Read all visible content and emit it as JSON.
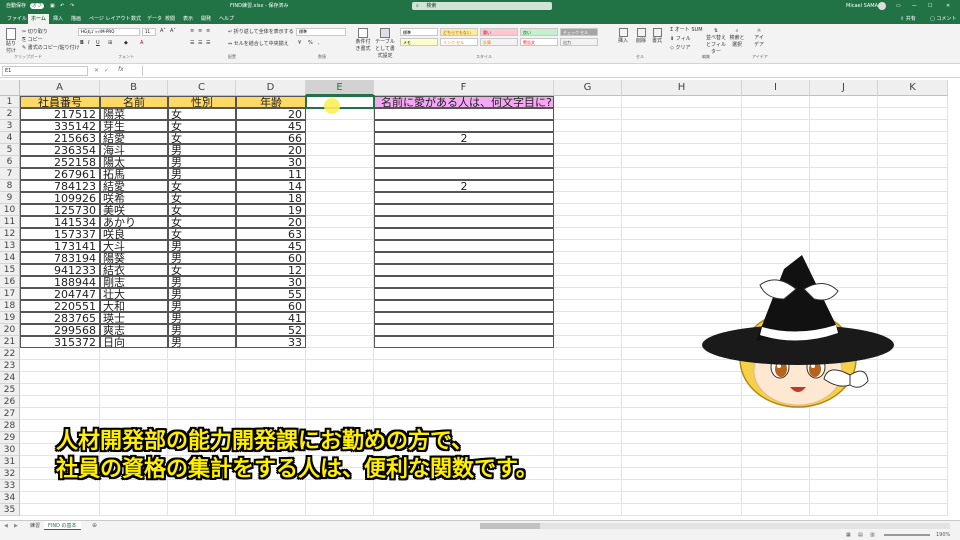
{
  "titlebar": {
    "autosave": "自動保存",
    "autosave_state": "オフ",
    "filename": "FIND練習.xlsx - 保存済み",
    "search_placeholder": "検索",
    "user": "Micael SAMA"
  },
  "tabs": [
    "ファイル",
    "ホーム",
    "挿入",
    "描画",
    "ページ レイアウト",
    "数式",
    "データ",
    "校閲",
    "表示",
    "開発",
    "ヘルプ"
  ],
  "active_tab": "ホーム",
  "share": "共有",
  "comment": "コメント",
  "ribbon": {
    "paste": "貼り付け",
    "cut": "切り取り",
    "copy": "コピー",
    "format_painter": "書式のコピー/貼り付け",
    "clipboard": "クリップボード",
    "font_name": "HG丸ｺﾞｼｯｸM-PRO",
    "font_size": "11",
    "font_group": "フォント",
    "wrap": "折り返して全体を表示する",
    "merge": "セルを結合して中央揃え",
    "align_group": "配置",
    "number_format": "標準",
    "number_group": "数値",
    "cond_format": "条件付き書式",
    "table_format": "テーブルとして書式設定",
    "styles": [
      "標準",
      "どちらでもない",
      "悪い",
      "良い",
      "チェック セル",
      "メモ",
      "リンク セル",
      "計算",
      "警告文",
      "出力"
    ],
    "style_group": "スタイル",
    "insert": "挿入",
    "delete": "削除",
    "format": "書式",
    "cell_group": "セル",
    "autosum": "オート SUM",
    "fill": "フィル",
    "clear": "クリア",
    "sort": "並べ替えとフィルター",
    "find": "検索と選択",
    "edit_group": "編集",
    "ideas": "アイデア",
    "ideas_group": "アイデア"
  },
  "formula_bar": {
    "name_box": "E1",
    "fx": "fx",
    "content": ""
  },
  "columns": [
    "A",
    "B",
    "C",
    "D",
    "E",
    "F",
    "G",
    "H",
    "I",
    "J",
    "K"
  ],
  "selected_column": "E",
  "headers": {
    "A": "社員番号",
    "B": "名前",
    "C": "性別",
    "D": "年齢",
    "F": "名前に愛がある人は、何文字目に?"
  },
  "rows": [
    {
      "id": "217512",
      "name": "陽菜",
      "sex": "女",
      "age": "20",
      "f": ""
    },
    {
      "id": "335142",
      "name": "芽生",
      "sex": "女",
      "age": "45",
      "f": ""
    },
    {
      "id": "215663",
      "name": "結愛",
      "sex": "女",
      "age": "66",
      "f": "2"
    },
    {
      "id": "236354",
      "name": "海斗",
      "sex": "男",
      "age": "20",
      "f": ""
    },
    {
      "id": "252158",
      "name": "陽太",
      "sex": "男",
      "age": "30",
      "f": ""
    },
    {
      "id": "267961",
      "name": "拓馬",
      "sex": "男",
      "age": "11",
      "f": ""
    },
    {
      "id": "784123",
      "name": "結愛",
      "sex": "女",
      "age": "14",
      "f": "2"
    },
    {
      "id": "109926",
      "name": "咲希",
      "sex": "女",
      "age": "18",
      "f": ""
    },
    {
      "id": "125730",
      "name": "美咲",
      "sex": "女",
      "age": "19",
      "f": ""
    },
    {
      "id": "141534",
      "name": "あかり",
      "sex": "女",
      "age": "20",
      "f": ""
    },
    {
      "id": "157337",
      "name": "咲良",
      "sex": "女",
      "age": "63",
      "f": ""
    },
    {
      "id": "173141",
      "name": "大斗",
      "sex": "男",
      "age": "45",
      "f": ""
    },
    {
      "id": "783194",
      "name": "陽葵",
      "sex": "男",
      "age": "60",
      "f": ""
    },
    {
      "id": "941233",
      "name": "結衣",
      "sex": "女",
      "age": "12",
      "f": ""
    },
    {
      "id": "188944",
      "name": "剛志",
      "sex": "男",
      "age": "30",
      "f": ""
    },
    {
      "id": "204747",
      "name": "壮大",
      "sex": "男",
      "age": "55",
      "f": ""
    },
    {
      "id": "220551",
      "name": "大和",
      "sex": "男",
      "age": "60",
      "f": ""
    },
    {
      "id": "283765",
      "name": "瑛士",
      "sex": "男",
      "age": "41",
      "f": ""
    },
    {
      "id": "299568",
      "name": "爽志",
      "sex": "男",
      "age": "52",
      "f": ""
    },
    {
      "id": "315372",
      "name": "日向",
      "sex": "男",
      "age": "33",
      "f": ""
    }
  ],
  "row_numbers": [
    "1",
    "2",
    "3",
    "4",
    "5",
    "6",
    "7",
    "8",
    "9",
    "10",
    "11",
    "12",
    "13",
    "14",
    "15",
    "16",
    "17",
    "18",
    "19",
    "20",
    "21",
    "22",
    "23",
    "24",
    "25",
    "26",
    "27",
    "28",
    "29",
    "30",
    "31",
    "32",
    "33",
    "34",
    "35"
  ],
  "overlay": {
    "line1": "人材開発部の能力開発課にお勤めの方で、",
    "line2": "社員の資格の集計をする人は、便利な関数です。"
  },
  "sheet_tabs": [
    "練習",
    "FIND の基本"
  ],
  "active_sheet": "FIND の基本",
  "status": {
    "zoom": "190%"
  },
  "colors": {
    "excel_green": "#217346",
    "header_yellow": "#ffd966",
    "header_pink": "#f4a8f4",
    "overlay_text": "#ffee00"
  }
}
